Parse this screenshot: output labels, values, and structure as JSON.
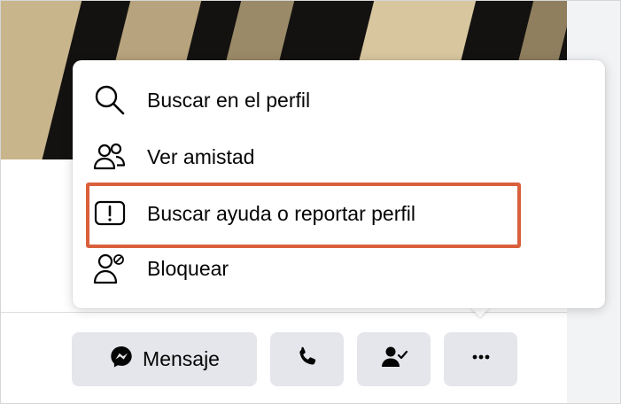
{
  "profile_menu": {
    "items": [
      {
        "label": "Buscar en el perfil",
        "icon": "search-icon"
      },
      {
        "label": "Ver amistad",
        "icon": "friends-icon"
      },
      {
        "label": "Buscar ayuda o reportar perfil",
        "icon": "report-icon",
        "highlighted": true
      },
      {
        "label": "Bloquear",
        "icon": "block-user-icon"
      }
    ]
  },
  "actions": {
    "message_label": "Mensaje",
    "message_icon": "messenger-icon",
    "call_icon": "phone-icon",
    "friends_status_icon": "friend-check-icon",
    "more_icon": "more-horizontal-icon"
  },
  "colors": {
    "highlight_border": "#d9603b",
    "button_bg": "#e4e6eb",
    "text": "#050505"
  }
}
